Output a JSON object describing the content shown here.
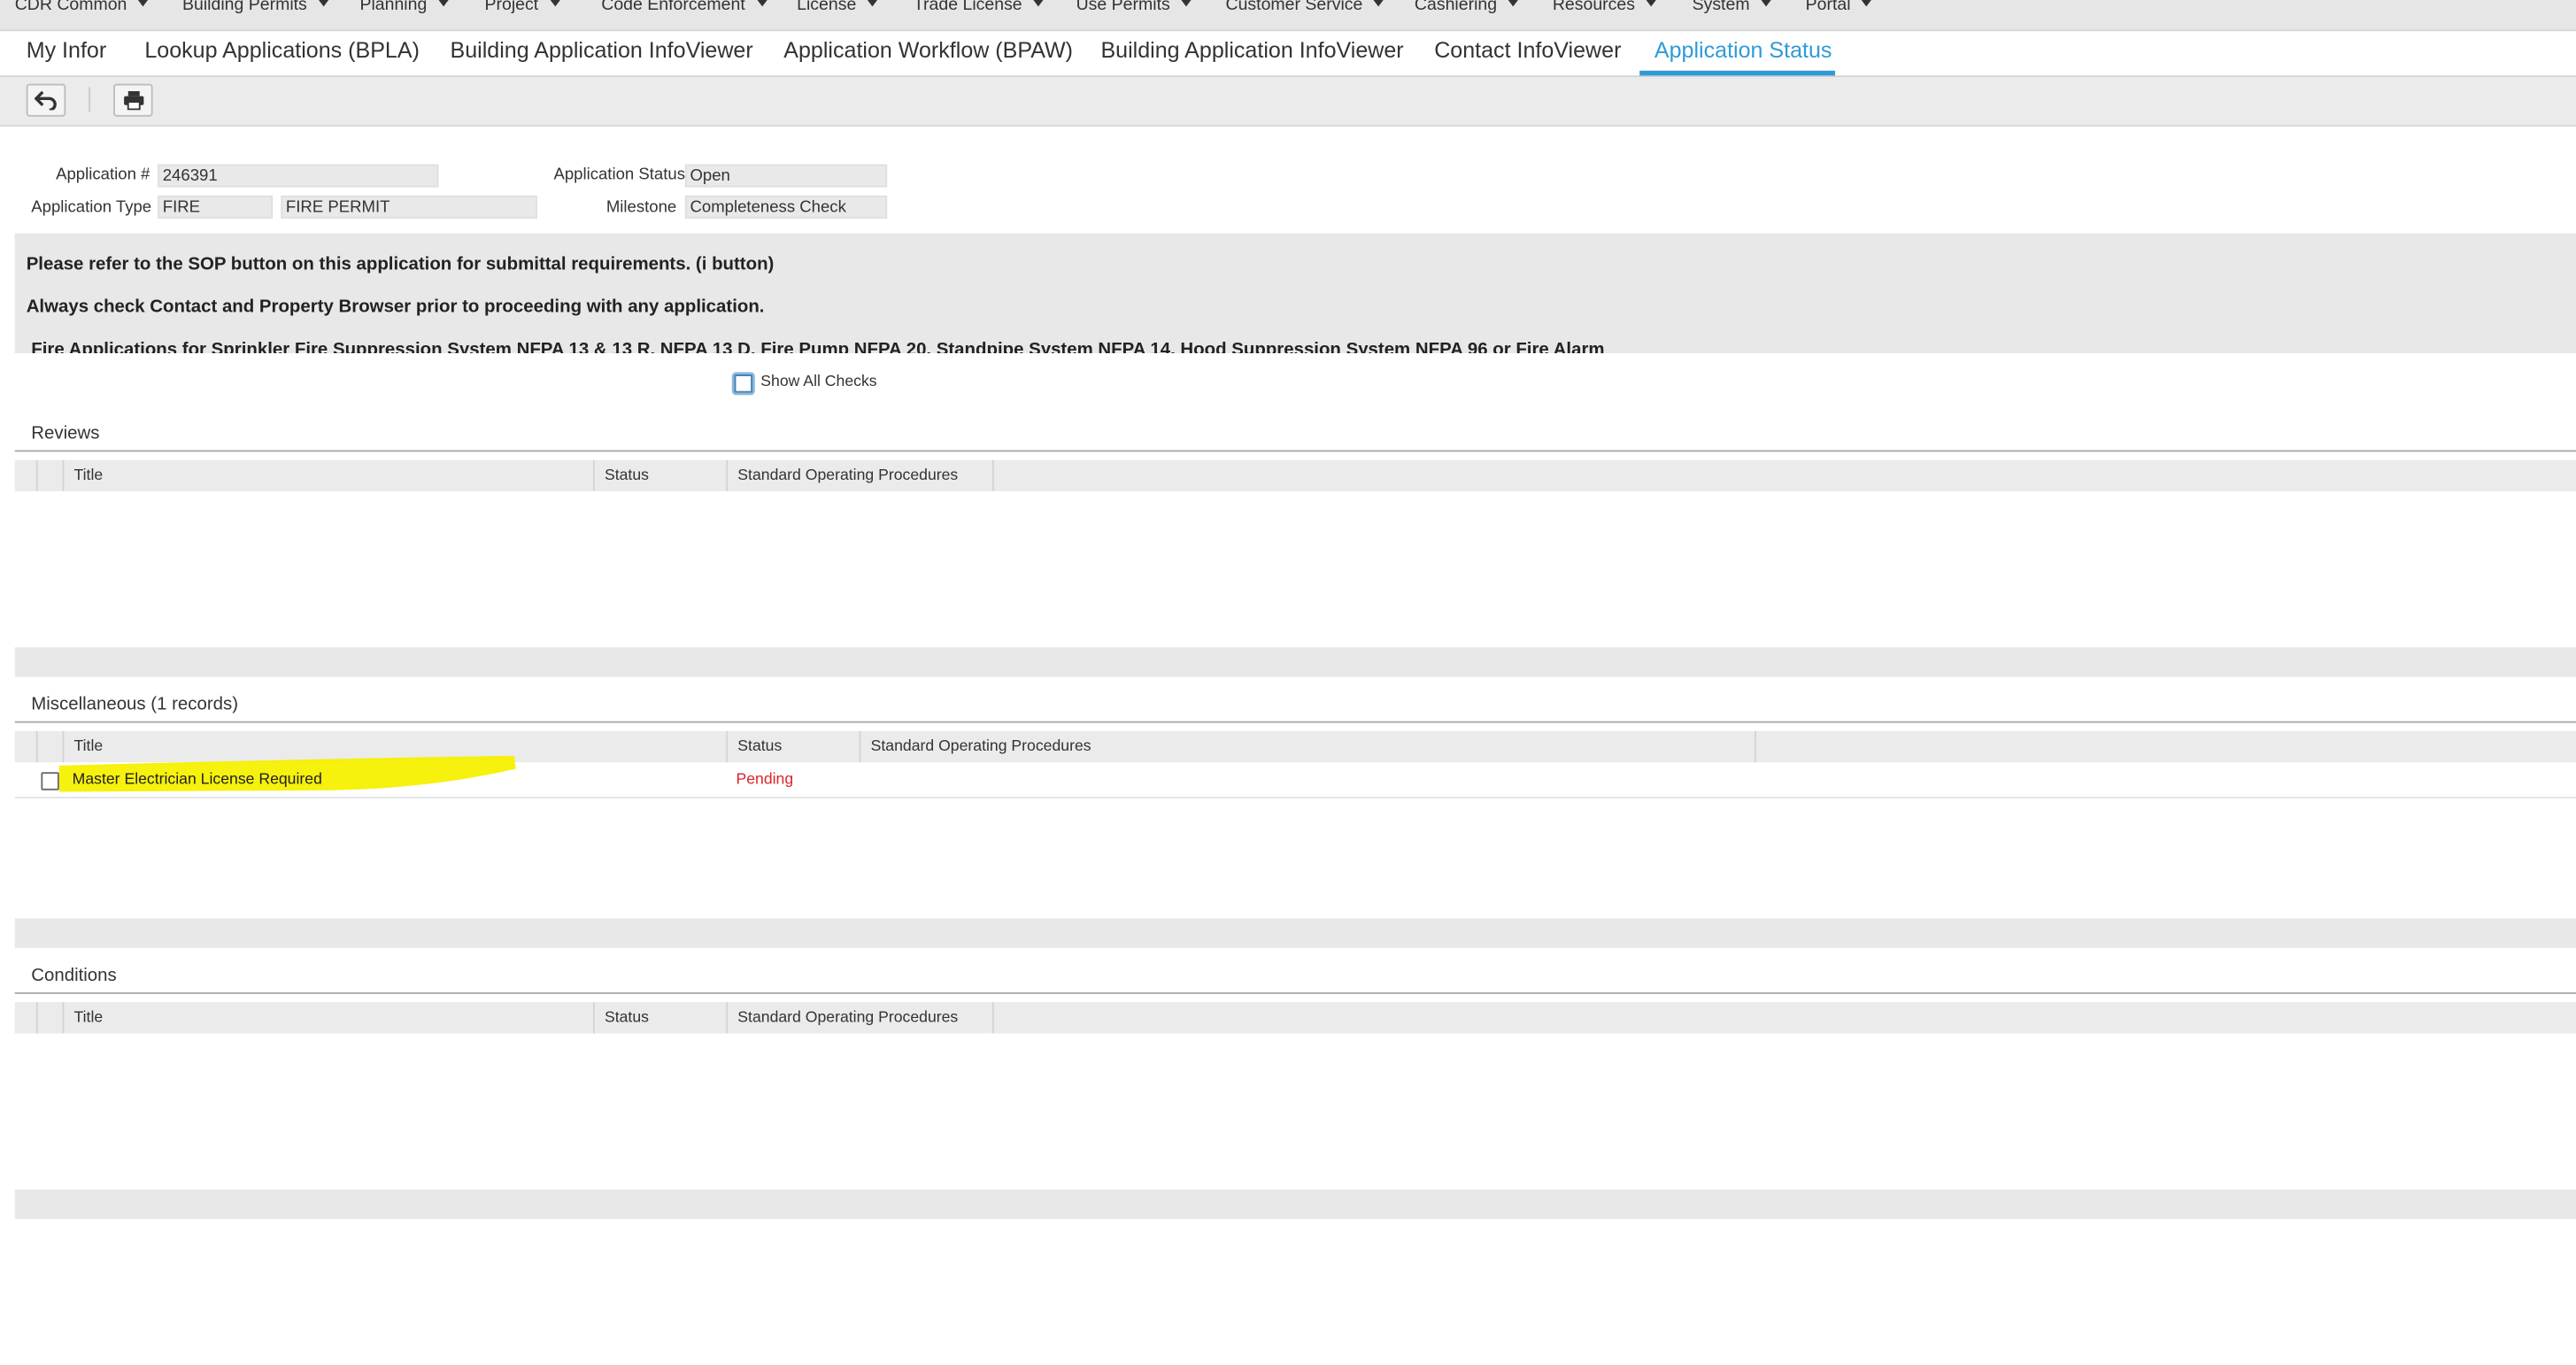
{
  "menu": {
    "items": [
      "CDR Common",
      "Building Permits",
      "Planning",
      "Project",
      "Code Enforcement",
      "License",
      "Trade License",
      "Use Permits",
      "Customer Service",
      "Cashiering",
      "Resources",
      "System",
      "Portal"
    ]
  },
  "tabs": [
    "My Infor",
    "Lookup Applications (BPLA)",
    "Building Application InfoViewer",
    "Application Workflow (BPAW)",
    "Building Application InfoViewer",
    "Contact InfoViewer",
    "Application Status"
  ],
  "active_tab": "Application Status",
  "toolbar": {
    "undo_icon": "undo-icon",
    "print_icon": "printer-icon"
  },
  "application": {
    "number_label": "Application #",
    "number": "246391",
    "type_label": "Application Type",
    "type_code": "FIRE",
    "type_desc": "FIRE PERMIT",
    "status_label": "Application Status",
    "status": "Open",
    "milestone_label": "Milestone",
    "milestone": "Completeness Check"
  },
  "notice": {
    "line1": "Please refer to the SOP button on this application for submittal requirements. (i button)",
    "line2": "Always check Contact and Property Browser prior to proceeding with any application.",
    "line3": "Fire Applications for Sprinkler Fire Suppression System NFPA 13 & 13 R, NFPA 13 D, Fire Pump NFPA 20, Standpipe System NFPA 14, Hood Suppression System NFPA 96 or Fire Alarm"
  },
  "show_all_checks": {
    "label": "Show All Checks",
    "checked": false
  },
  "columns": {
    "title": "Title",
    "status": "Status",
    "sop": "Standard Operating Procedures"
  },
  "reviews": {
    "title": "Reviews",
    "rows": []
  },
  "misc": {
    "title": "Miscellaneous (1 records)",
    "rows": [
      {
        "title": "Master Electrician License Required",
        "status": "Pending",
        "status_color": "#d9262c",
        "checked": false,
        "highlight_color": "#f5f000"
      }
    ]
  },
  "conditions": {
    "title": "Conditions",
    "rows": []
  },
  "colors": {
    "accent": "#2f9bd6",
    "pending": "#d9262c",
    "highlight": "#f5f000"
  }
}
